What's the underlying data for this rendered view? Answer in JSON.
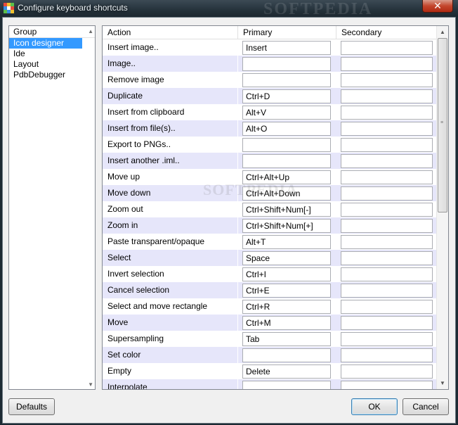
{
  "window": {
    "title": "Configure keyboard shortcuts",
    "watermark": "SOFTPEDIA",
    "close_label": "✕"
  },
  "groups": {
    "header": "Group",
    "items": [
      "Icon designer",
      "Ide",
      "Layout",
      "PdbDebugger"
    ],
    "selected": "Icon designer"
  },
  "table": {
    "headers": {
      "action": "Action",
      "primary": "Primary",
      "secondary": "Secondary"
    },
    "rows": [
      {
        "action": "Insert image..",
        "primary": "Insert",
        "secondary": ""
      },
      {
        "action": "Image..",
        "primary": "",
        "secondary": ""
      },
      {
        "action": "Remove image",
        "primary": "",
        "secondary": ""
      },
      {
        "action": "Duplicate",
        "primary": "Ctrl+D",
        "secondary": ""
      },
      {
        "action": "Insert from clipboard",
        "primary": "Alt+V",
        "secondary": ""
      },
      {
        "action": "Insert from file(s)..",
        "primary": "Alt+O",
        "secondary": ""
      },
      {
        "action": "Export to PNGs..",
        "primary": "",
        "secondary": ""
      },
      {
        "action": "Insert another .iml..",
        "primary": "",
        "secondary": ""
      },
      {
        "action": "Move up",
        "primary": "Ctrl+Alt+Up",
        "secondary": ""
      },
      {
        "action": "Move down",
        "primary": "Ctrl+Alt+Down",
        "secondary": ""
      },
      {
        "action": "Zoom out",
        "primary": "Ctrl+Shift+Num[-]",
        "secondary": ""
      },
      {
        "action": "Zoom in",
        "primary": "Ctrl+Shift+Num[+]",
        "secondary": ""
      },
      {
        "action": "Paste transparent/opaque",
        "primary": "Alt+T",
        "secondary": ""
      },
      {
        "action": "Select",
        "primary": "Space",
        "secondary": ""
      },
      {
        "action": "Invert selection",
        "primary": "Ctrl+I",
        "secondary": ""
      },
      {
        "action": "Cancel selection",
        "primary": "Ctrl+E",
        "secondary": ""
      },
      {
        "action": "Select and move rectangle",
        "primary": "Ctrl+R",
        "secondary": ""
      },
      {
        "action": "Move",
        "primary": "Ctrl+M",
        "secondary": ""
      },
      {
        "action": "Supersampling",
        "primary": "Tab",
        "secondary": ""
      },
      {
        "action": "Set color",
        "primary": "",
        "secondary": ""
      },
      {
        "action": "Empty",
        "primary": "Delete",
        "secondary": ""
      },
      {
        "action": "Interpolate",
        "primary": "",
        "secondary": ""
      }
    ]
  },
  "buttons": {
    "defaults": "Defaults",
    "ok": "OK",
    "cancel": "Cancel"
  },
  "colors": {
    "selection": "#3399ff",
    "alt_row": "#e6e6fa",
    "close": "#c3452c"
  }
}
